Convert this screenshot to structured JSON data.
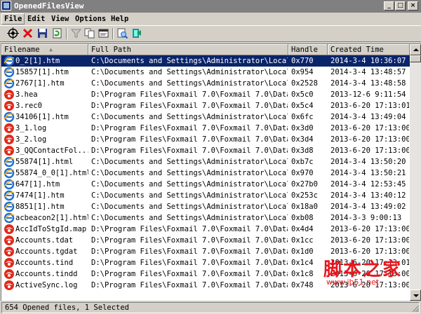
{
  "window": {
    "title": "OpenedFilesView"
  },
  "menu": [
    "File",
    "Edit",
    "View",
    "Options",
    "Help"
  ],
  "toolbar": [
    "properties-icon",
    "delete-icon",
    "save-icon",
    "refresh-icon",
    "filter-icon",
    "copy-icon",
    "html-report-icon",
    "find-icon",
    "exit-icon"
  ],
  "columns": [
    "Filename",
    "Full Path",
    "Handle",
    "Created Time"
  ],
  "rows": [
    {
      "name": "0_2[1].htm",
      "path": "C:\\Documents and Settings\\Administrator\\Local...",
      "handle": "0x770",
      "time": "2014-3-4 10:36:07",
      "icon": "ie",
      "selected": true
    },
    {
      "name": "15857[1].htm",
      "path": "C:\\Documents and Settings\\Administrator\\Local...",
      "handle": "0x954",
      "time": "2014-3-4 13:48:57",
      "icon": "ie"
    },
    {
      "name": "2767[1].htm",
      "path": "C:\\Documents and Settings\\Administrator\\Local...",
      "handle": "0x2528",
      "time": "2014-3-4 13:48:58",
      "icon": "ie"
    },
    {
      "name": "3.hea",
      "path": "D:\\Program Files\\Foxmail 7.0\\Foxmail 7.0\\Data...",
      "handle": "0x5c0",
      "time": "2013-12-6 9:11:54",
      "icon": "fox"
    },
    {
      "name": "3.rec0",
      "path": "D:\\Program Files\\Foxmail 7.0\\Foxmail 7.0\\Data...",
      "handle": "0x5c4",
      "time": "2013-6-20 17:13:01",
      "icon": "fox"
    },
    {
      "name": "34106[1].htm",
      "path": "C:\\Documents and Settings\\Administrator\\Local...",
      "handle": "0x6fc",
      "time": "2014-3-4 13:49:04",
      "icon": "ie"
    },
    {
      "name": "3_1.log",
      "path": "D:\\Program Files\\Foxmail 7.0\\Foxmail 7.0\\Data...",
      "handle": "0x3d0",
      "time": "2013-6-20 17:13:00",
      "icon": "fox"
    },
    {
      "name": "3_2.log",
      "path": "D:\\Program Files\\Foxmail 7.0\\Foxmail 7.0\\Data...",
      "handle": "0x3d4",
      "time": "2013-6-20 17:13:00",
      "icon": "fox"
    },
    {
      "name": "3_QQContactFol...",
      "path": "D:\\Program Files\\Foxmail 7.0\\Foxmail 7.0\\Data...",
      "handle": "0x3d8",
      "time": "2013-6-20 17:13:00",
      "icon": "fox"
    },
    {
      "name": "55874[1].html",
      "path": "C:\\Documents and Settings\\Administrator\\Local...",
      "handle": "0xb7c",
      "time": "2014-3-4 13:50:20",
      "icon": "ie"
    },
    {
      "name": "55874_0_0[1].html",
      "path": "C:\\Documents and Settings\\Administrator\\Local...",
      "handle": "0x970",
      "time": "2014-3-4 13:50:21",
      "icon": "ie"
    },
    {
      "name": "647[1].htm",
      "path": "C:\\Documents and Settings\\Administrator\\Local...",
      "handle": "0x27b0",
      "time": "2014-3-4 12:53:45",
      "icon": "ie"
    },
    {
      "name": "7474[1].htm",
      "path": "C:\\Documents and Settings\\Administrator\\Local...",
      "handle": "0x253c",
      "time": "2014-3-4 13:40:12",
      "icon": "ie"
    },
    {
      "name": "8851[1].htm",
      "path": "C:\\Documents and Settings\\Administrator\\Local...",
      "handle": "0x18a0",
      "time": "2014-3-4 13:49:02",
      "icon": "ie"
    },
    {
      "name": "acbeacon2[1].html",
      "path": "C:\\Documents and Settings\\Administrator\\Local...",
      "handle": "0xb08",
      "time": "2014-3-3 9:00:13",
      "icon": "ie"
    },
    {
      "name": "AccIdToStgId.map",
      "path": "D:\\Program Files\\Foxmail 7.0\\Foxmail 7.0\\Data...",
      "handle": "0x4d4",
      "time": "2013-6-20 17:13:00",
      "icon": "fox"
    },
    {
      "name": "Accounts.tdat",
      "path": "D:\\Program Files\\Foxmail 7.0\\Foxmail 7.0\\Data...",
      "handle": "0x1cc",
      "time": "2013-6-20 17:13:00",
      "icon": "fox"
    },
    {
      "name": "Accounts.tgdat",
      "path": "D:\\Program Files\\Foxmail 7.0\\Foxmail 7.0\\Data...",
      "handle": "0x1d0",
      "time": "2013-6-20 17:13:00",
      "icon": "fox"
    },
    {
      "name": "Accounts.tind",
      "path": "D:\\Program Files\\Foxmail 7.0\\Foxmail 7.0\\Data...",
      "handle": "0x1c4",
      "time": "2013-6-20 17:13:01",
      "icon": "fox"
    },
    {
      "name": "Accounts.tindd",
      "path": "D:\\Program Files\\Foxmail 7.0\\Foxmail 7.0\\Data...",
      "handle": "0x1c8",
      "time": "2013-6-20 17:13:00",
      "icon": "fox"
    },
    {
      "name": "ActiveSync.log",
      "path": "D:\\Program Files\\Foxmail 7.0\\Foxmail 7.0\\Data...",
      "handle": "0x748",
      "time": "2013-6-20 17:13:00",
      "icon": "fox"
    }
  ],
  "status": {
    "text": "654 Opened files, 1 Selected"
  },
  "watermark": {
    "main": "脚本之家",
    "sub": "www.jb51.net"
  }
}
